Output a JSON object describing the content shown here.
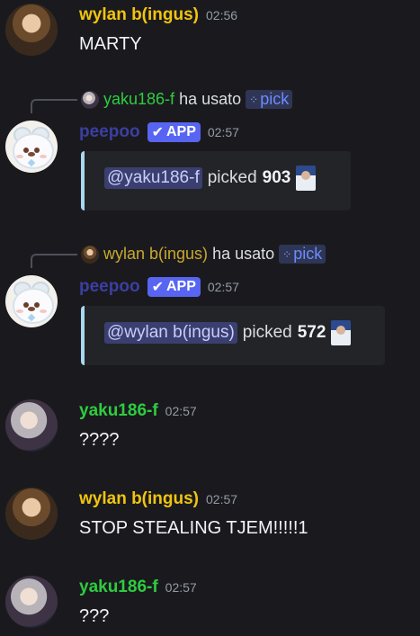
{
  "messages": [
    {
      "author": "wylan b(ingus)",
      "time": "02:56",
      "text": "MARTY"
    },
    {
      "reply": {
        "author": "yaku186-f",
        "action": "ha usato",
        "command": "pick"
      },
      "author": "peepoo",
      "badge": "APP",
      "badge_icon": "check",
      "time": "02:57",
      "embed": {
        "mention": "@yaku186-f",
        "verb": "picked",
        "value": "903"
      }
    },
    {
      "reply": {
        "author": "wylan b(ingus)",
        "action": "ha usato",
        "command": "pick"
      },
      "author": "peepoo",
      "badge": "APP",
      "badge_icon": "check",
      "time": "02:57",
      "embed": {
        "mention": "@wylan b(ingus)",
        "verb": "picked",
        "value": "572"
      }
    },
    {
      "author": "yaku186-f",
      "time": "02:57",
      "text": "????"
    },
    {
      "author": "wylan b(ingus)",
      "time": "02:57",
      "text": "STOP STEALING TJEM!!!!!1"
    },
    {
      "author": "yaku186-f",
      "time": "02:57",
      "text": "???"
    }
  ],
  "colors": {
    "background": "#1a1a1e",
    "wylan_name": "#f1c40f",
    "yaku_name": "#2ecc40",
    "app_badge": "#5865f2",
    "embed_accent": "#a8d8f0"
  }
}
